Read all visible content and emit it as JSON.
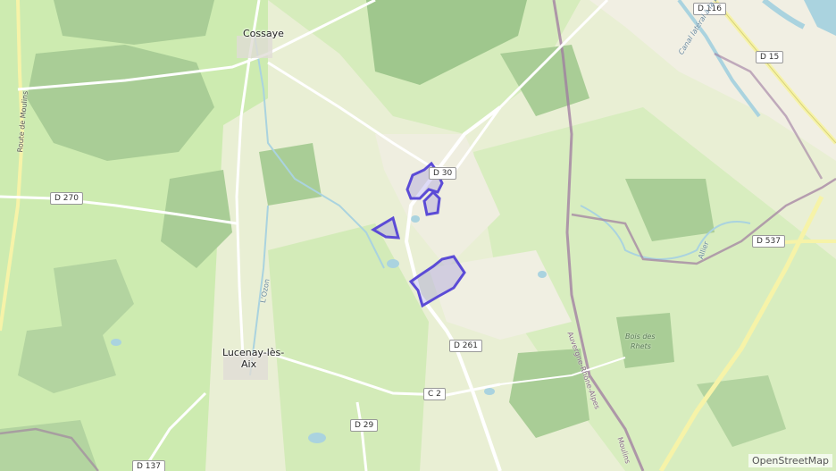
{
  "towns": {
    "cossaye": "Cossaye",
    "lucenay_line1": "Lucenay-lès-",
    "lucenay_line2": "Aix"
  },
  "roads": {
    "d116": "D 116",
    "d15": "D 15",
    "d270": "D 270",
    "d537": "D 537",
    "d30": "D 30",
    "d261": "D 261",
    "c2": "C 2",
    "d29": "D 29",
    "d137": "D 137"
  },
  "features": {
    "bois_line1": "Bois des",
    "bois_line2": "Rhets",
    "canal": "Canal latéral à la Loire",
    "route_moulins": "Route de Moulins",
    "allier": "Allier",
    "auvergne": "Auvergne-Rhône-Alpes",
    "moulins": "Moulins",
    "ozon": "L'Ozon"
  },
  "attribution": "OpenStreetMap",
  "colors": {
    "forest": "#aed09a",
    "meadow": "#cdebb0",
    "farmland": "#eef0d5",
    "water": "#aad3df",
    "boundary": "#9f7aa0",
    "highlight": "#5b4bd6"
  }
}
